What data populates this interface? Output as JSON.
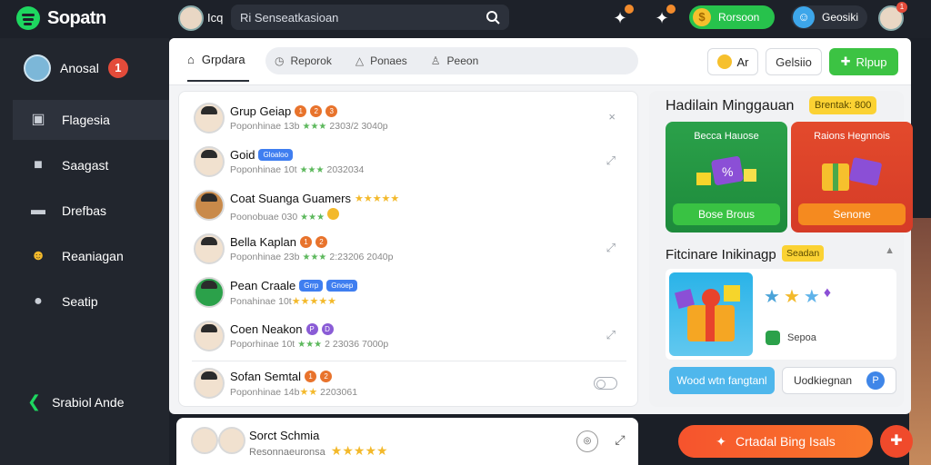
{
  "app": {
    "name": "Sopatn",
    "username": "Icq"
  },
  "search": {
    "text": "Ri Senseatkasioan"
  },
  "top": {
    "coins_label": "Rorsoon",
    "user_label": "Geosiki",
    "coin_symbol": "$",
    "notif_badge": "1"
  },
  "sidebar": {
    "profile": {
      "name": "Anosal",
      "badge": "1"
    },
    "items": [
      {
        "label": "Flagesia",
        "icon": "calendar-icon"
      },
      {
        "label": "Saagast",
        "icon": "lock-icon"
      },
      {
        "label": "Drefbas",
        "icon": "folder-icon"
      },
      {
        "label": "Reaniagan",
        "icon": "group-icon"
      },
      {
        "label": "Seatip",
        "icon": "person-icon"
      }
    ],
    "bottom_label": "Srabiol Ande"
  },
  "tabs": {
    "home": "Grpdara",
    "items": [
      "Reporok",
      "Ponaes",
      "Peeon"
    ]
  },
  "actions": {
    "ar": "Ar",
    "cal": "Gelsiio",
    "group": "Rlpup"
  },
  "list": [
    {
      "name": "Grup Geiap",
      "sub": "Poponhinae 13b",
      "sub2": "2303/2 3040p",
      "tags": [
        "1",
        "2",
        "3"
      ],
      "action": "×"
    },
    {
      "name": "Goid",
      "sub": "Poponhinae 10t",
      "sub2": "2032034",
      "tag_label": "Gloaloo",
      "action": "⤢"
    },
    {
      "name": "Coat Suanga Guamers",
      "sub": "Poonobuae 030",
      "tags": [],
      "action": ""
    },
    {
      "name": "Bella Kaplan",
      "sub": "Poponhinae 23b",
      "sub2": "2:23206 2040p",
      "tags": [
        "1",
        "2"
      ],
      "action": "⤢"
    },
    {
      "name": "Pean Craale",
      "sub": "Ponahinae 10t",
      "tag_labels": [
        "Grrp",
        "Gnoep"
      ],
      "action": ""
    },
    {
      "name": "Coen Neakon",
      "sub": "Poporhinae 10t",
      "sub2": "2 23036 7000p",
      "tags": [
        "P",
        "D"
      ],
      "action": "⤢"
    },
    {
      "name": "Sofan Semtal",
      "sub": "Poponhinae 14b",
      "sub2": "2203061",
      "tags": [
        "1",
        "2"
      ],
      "action": ""
    }
  ],
  "right": {
    "title": "Hadilain Minggauan",
    "badge": "Brentak: 800",
    "card1": {
      "title": "Becca Hauose",
      "button": "Bose Brous"
    },
    "card2": {
      "title": "Raions Hegnnois",
      "button": "Senone"
    },
    "sub_title": "Fitcinare Inikinagp",
    "sub_badge": "Seadan",
    "small_label": "Sepoa",
    "btn_blue": "Wood wtn fangtanl",
    "btn_white": "Uodkiegnan",
    "btn_white_icon": "P"
  },
  "bottombar": {
    "name": "Sorct Schmia",
    "sub": "Resonnaeuronsa"
  },
  "cta": {
    "label": "Crtadal Bing Isals"
  },
  "colors": {
    "accent_green": "#1ed760",
    "button_green": "#3cc343",
    "cta_orange": "#f6532d",
    "badge_red": "#e34b3a",
    "star_gold": "#f3b92b"
  }
}
